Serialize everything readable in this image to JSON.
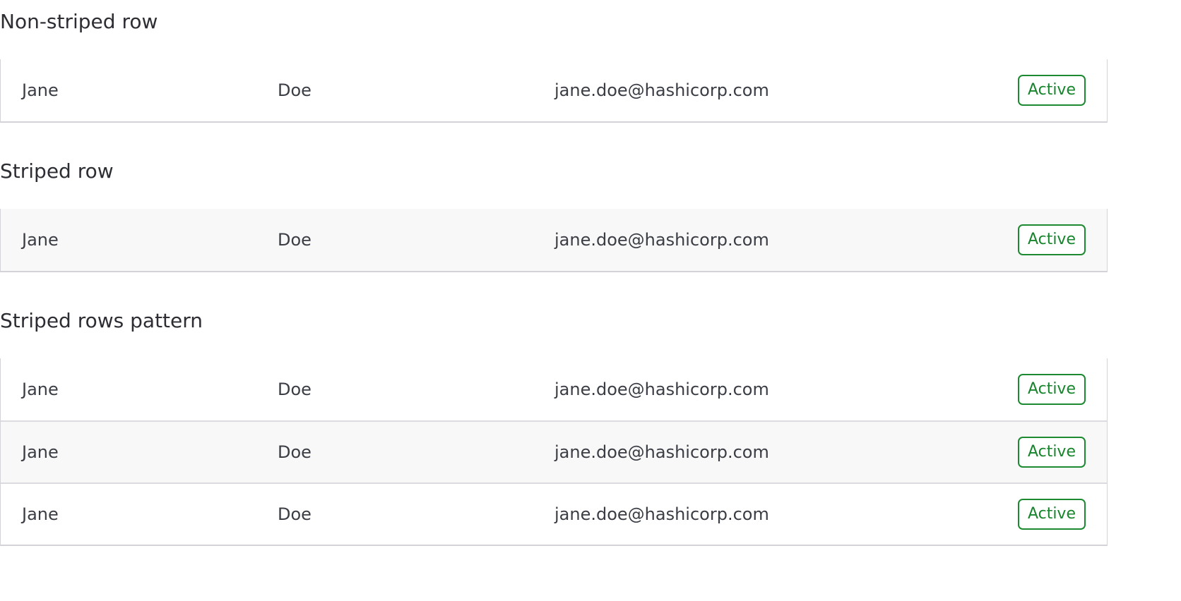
{
  "sections": [
    {
      "title": "Non-striped row",
      "rows": [
        {
          "first": "Jane",
          "last": "Doe",
          "email": "jane.doe@hashicorp.com",
          "status": "Active"
        }
      ]
    },
    {
      "title": "Striped row",
      "rows": [
        {
          "first": "Jane",
          "last": "Doe",
          "email": "jane.doe@hashicorp.com",
          "status": "Active"
        }
      ]
    },
    {
      "title": "Striped rows pattern",
      "rows": [
        {
          "first": "Jane",
          "last": "Doe",
          "email": "jane.doe@hashicorp.com",
          "status": "Active"
        },
        {
          "first": "Jane",
          "last": "Doe",
          "email": "jane.doe@hashicorp.com",
          "status": "Active"
        },
        {
          "first": "Jane",
          "last": "Doe",
          "email": "jane.doe@hashicorp.com",
          "status": "Active"
        }
      ]
    }
  ],
  "colors": {
    "badge": "#16852c",
    "stripe": "#f8f8f8",
    "border": "#d4d4d8"
  }
}
